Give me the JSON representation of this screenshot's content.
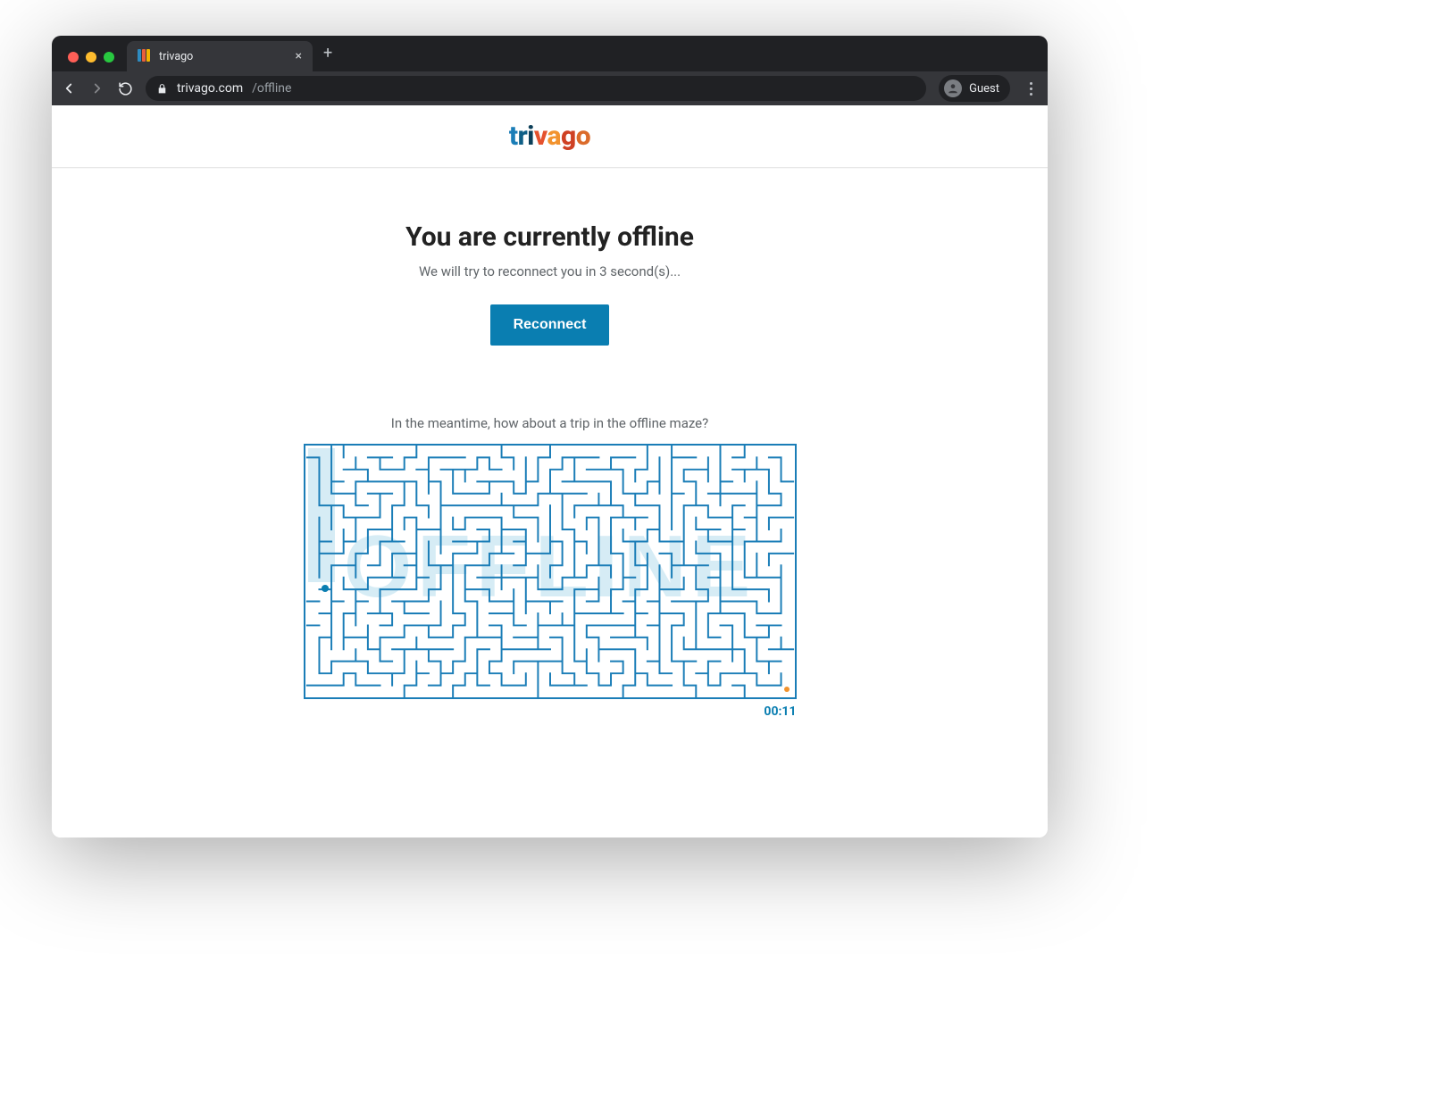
{
  "browser": {
    "tab_title": "trivago",
    "url_host": "trivago.com",
    "url_path": "/offline",
    "guest_label": "Guest"
  },
  "logo": {
    "chars": [
      "t",
      "r",
      "i",
      "v",
      "a",
      "g",
      "o"
    ]
  },
  "offline": {
    "heading": "You are currently offline",
    "subtext": "We will try to reconnect you in 3 second(s)...",
    "button_label": "Reconnect"
  },
  "maze": {
    "caption": "In the meantime, how about a trip in the offline maze?",
    "ghost_text": "OFFLINE",
    "timer": "00:11"
  },
  "colors": {
    "primary": "#0a7eb1",
    "maze_line": "#1a7db7",
    "ghost": "#d6ecf5",
    "exit": "#f2932e"
  }
}
